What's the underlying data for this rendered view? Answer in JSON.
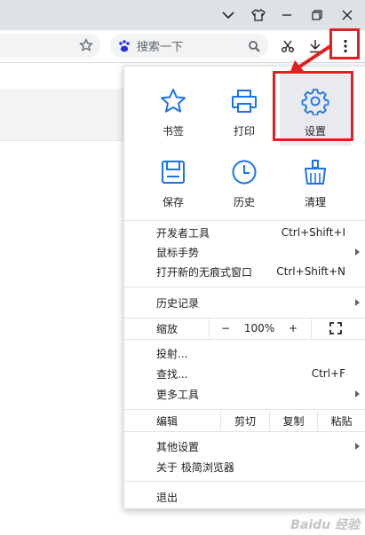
{
  "window": {
    "controls": [
      "chevron-down-icon",
      "shirt-icon",
      "minimize-icon",
      "restore-icon",
      "close-icon"
    ]
  },
  "toolbar": {
    "search_placeholder": "搜索一下",
    "icons": [
      "star-icon",
      "baidu-paw-icon",
      "search-icon",
      "scissors-icon",
      "download-icon",
      "more-vertical-icon"
    ]
  },
  "menu": {
    "grid": [
      {
        "label": "书签",
        "icon": "star-outline-icon"
      },
      {
        "label": "打印",
        "icon": "printer-icon"
      },
      {
        "label": "设置",
        "icon": "gear-icon"
      },
      {
        "label": "保存",
        "icon": "save-icon"
      },
      {
        "label": "历史",
        "icon": "clock-icon"
      },
      {
        "label": "清理",
        "icon": "broom-icon"
      }
    ],
    "tools": [
      {
        "label": "开发者工具",
        "shortcut": "Ctrl+Shift+I"
      },
      {
        "label": "鼠标手势",
        "shortcut": ""
      },
      {
        "label": "打开新的无痕式窗口",
        "shortcut": "Ctrl+Shift+N"
      }
    ],
    "history": {
      "label": "历史记录"
    },
    "zoom": {
      "label": "缩放",
      "minus": "−",
      "value": "100%",
      "plus": "+",
      "fullscreen_icon": "fullscreen-icon"
    },
    "page_tools": [
      {
        "label": "投射...",
        "shortcut": ""
      },
      {
        "label": "查找...",
        "shortcut": "Ctrl+F"
      },
      {
        "label": "更多工具",
        "shortcut": ""
      }
    ],
    "edit": {
      "label": "编辑",
      "cut": "剪切",
      "copy": "复制",
      "paste": "粘贴"
    },
    "other": [
      {
        "label": "其他设置"
      },
      {
        "label": "关于 极简浏览器"
      }
    ],
    "exit": {
      "label": "退出"
    }
  },
  "annotation": {
    "color": "#e02020"
  },
  "watermark": "Baidu 经验"
}
